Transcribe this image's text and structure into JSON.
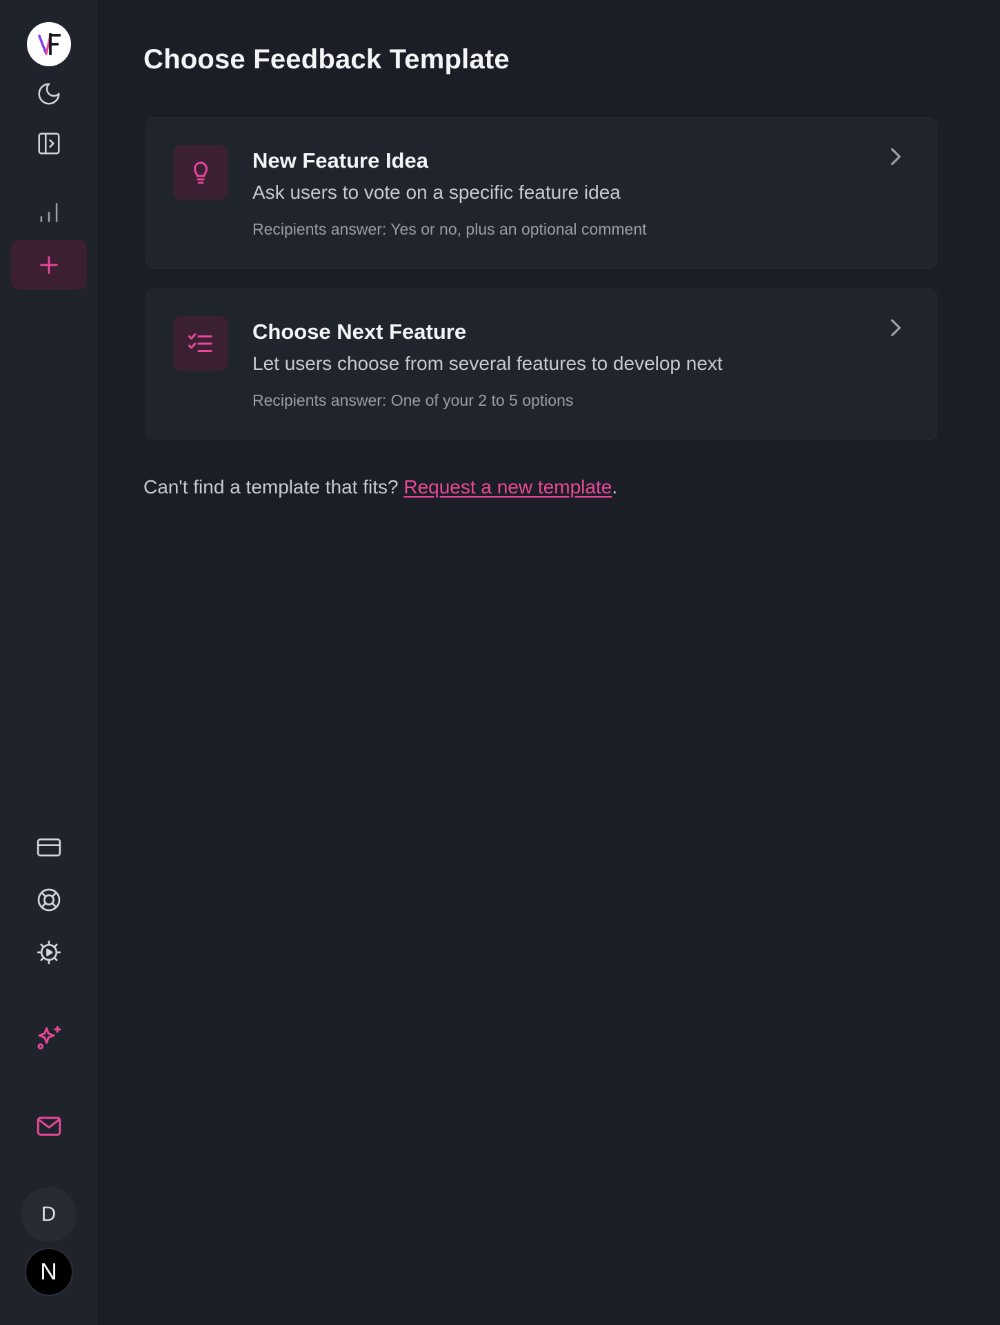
{
  "colors": {
    "accent": "#ec4899",
    "background": "#1b1e26",
    "sidebar": "#1f232b",
    "card": "#20242d",
    "icon_tile": "#3b2033"
  },
  "sidebar": {
    "logo_icon": "vf-logo-icon",
    "top_items": [
      {
        "name": "theme-toggle",
        "icon": "moon-icon"
      },
      {
        "name": "toggle-sidebar",
        "icon": "sidebar-expand-icon"
      },
      {
        "name": "analytics",
        "icon": "bar-chart-icon"
      },
      {
        "name": "create",
        "icon": "plus-icon",
        "active": true
      }
    ],
    "bottom_items": [
      {
        "name": "billing",
        "icon": "credit-card-icon"
      },
      {
        "name": "support",
        "icon": "life-buoy-icon"
      },
      {
        "name": "settings",
        "icon": "gear-icon"
      },
      {
        "name": "whats-new",
        "icon": "sparkles-icon"
      },
      {
        "name": "messages",
        "icon": "mail-icon"
      }
    ],
    "user_initial": "D",
    "workspace_initial": "N"
  },
  "main": {
    "title": "Choose Feedback Template",
    "templates": [
      {
        "icon": "lightbulb-icon",
        "title": "New Feature Idea",
        "description": "Ask users to vote on a specific feature idea",
        "meta": "Recipients answer: Yes or no, plus an optional comment"
      },
      {
        "icon": "checklist-icon",
        "title": "Choose Next Feature",
        "description": "Let users choose from several features to develop next",
        "meta": "Recipients answer: One of your 2 to 5 options"
      }
    ],
    "footer": {
      "text": "Can't find a template that fits?",
      "link_label": "Request a new template",
      "suffix": "."
    }
  }
}
